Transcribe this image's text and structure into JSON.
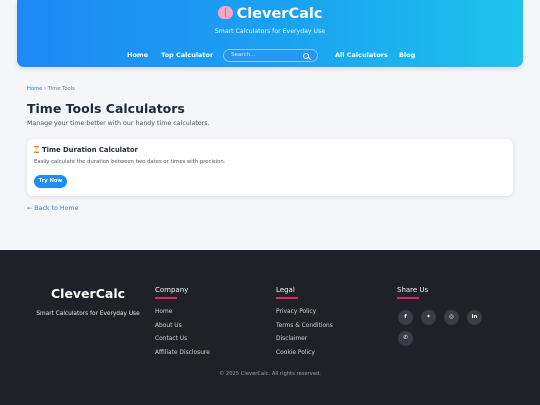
{
  "header": {
    "brand": "CleverCalc",
    "tagline": "Smart Calculators for Everyday Use",
    "nav": {
      "home": "Home",
      "top_calculator": "Top Calculator",
      "all_calculators": "All Calculators",
      "blog": "Blog"
    },
    "search": {
      "placeholder": "Search..."
    }
  },
  "breadcrumb": {
    "home": "Home",
    "separator": "›",
    "current": "Time Tools"
  },
  "page": {
    "title": "Time Tools Calculators",
    "subtitle": "Manage your time better with our handy time calculators."
  },
  "cards": [
    {
      "icon": "hourglass-icon",
      "title": "Time Duration Calculator",
      "description": "Easily calculate the duration between two dates or times with precision.",
      "button": "Try Now"
    }
  ],
  "back_link": "← Back to Home",
  "footer": {
    "brand": "CleverCalc",
    "tagline": "Smart Calculators for Everyday Use",
    "company": {
      "heading": "Company",
      "links": [
        "Home",
        "About Us",
        "Contact Us",
        "Affiliate Disclosure"
      ]
    },
    "legal": {
      "heading": "Legal",
      "links": [
        "Privacy Policy",
        "Terms & Conditions",
        "Disclaimer",
        "Cookie Policy"
      ]
    },
    "share": {
      "heading": "Share Us",
      "icons": [
        "facebook-icon",
        "twitter-icon",
        "instagram-icon",
        "linkedin-icon",
        "whatsapp-icon"
      ]
    },
    "copyright": "© 2025 CleverCalc. All rights reserved."
  },
  "colors": {
    "accent": "#1d8ff0",
    "footer_bg": "#1f2128",
    "underline": "#e0266b"
  }
}
